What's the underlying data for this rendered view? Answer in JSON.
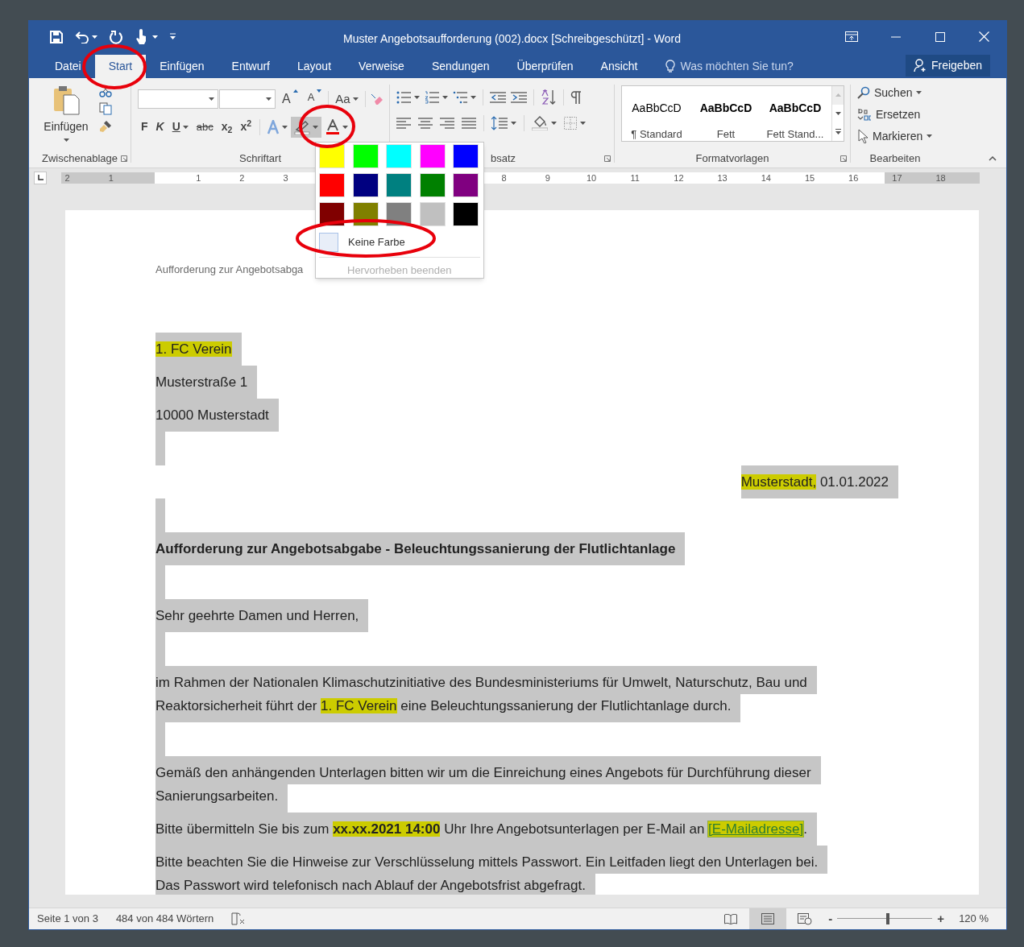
{
  "window": {
    "title": "Muster Angebotsaufforderung (002).docx [Schreibgeschützt] - Word"
  },
  "menu_tabs": [
    {
      "label": "Datei",
      "selected": false
    },
    {
      "label": "Start",
      "selected": true
    },
    {
      "label": "Einfügen",
      "selected": false
    },
    {
      "label": "Entwurf",
      "selected": false
    },
    {
      "label": "Layout",
      "selected": false
    },
    {
      "label": "Verweise",
      "selected": false
    },
    {
      "label": "Sendungen",
      "selected": false
    },
    {
      "label": "Überprüfen",
      "selected": false
    },
    {
      "label": "Ansicht",
      "selected": false
    }
  ],
  "tell_me": {
    "placeholder": "Was möchten Sie tun?"
  },
  "share_button": "Freigeben",
  "ribbon": {
    "clipboard": {
      "paste": "Einfügen",
      "label": "Zwischenablage"
    },
    "font": {
      "label": "Schriftart",
      "grow": "A",
      "shrink": "A",
      "change_case": "Aa",
      "bold": "F",
      "italic": "K",
      "underline": "U",
      "strike": "abc",
      "subscript": "x$_{2}$",
      "superscript": "x$^{2}$",
      "highlight_pressed": true
    },
    "paragraph": {
      "label": "bsatz"
    },
    "styles": {
      "label": "Formatvorlagen",
      "items": [
        {
          "preview": "AaBbCcD",
          "name": "¶ Standard",
          "bold": false
        },
        {
          "preview": "AaBbCcD",
          "name": "Fett",
          "bold": true
        },
        {
          "preview": "AaBbCcD",
          "name": "Fett Stand...",
          "bold": true
        }
      ]
    },
    "editing": {
      "label": "Bearbeiten",
      "items": [
        {
          "label": "Suchen",
          "kind": "search"
        },
        {
          "label": "Ersetzen",
          "kind": "replace"
        },
        {
          "label": "Markieren",
          "kind": "select"
        }
      ]
    }
  },
  "ruler": {
    "numbers": [
      "2",
      "1",
      "1",
      "2",
      "3",
      "8",
      "9",
      "10",
      "11",
      "12",
      "13",
      "14",
      "15",
      "16",
      "17",
      "18"
    ]
  },
  "highlight_menu": {
    "colors": [
      {
        "color": "#ffff00"
      },
      {
        "color": "#00ff00"
      },
      {
        "color": "#00ffff"
      },
      {
        "color": "#ff00ff"
      },
      {
        "color": "#0000ff"
      },
      {
        "color": "#ff0000"
      },
      {
        "color": "#000080"
      },
      {
        "color": "#008080"
      },
      {
        "color": "#008000"
      },
      {
        "color": "#800080"
      },
      {
        "color": "#800000"
      },
      {
        "color": "#808000"
      },
      {
        "color": "#808080"
      },
      {
        "color": "#c0c0c0"
      },
      {
        "color": "#000000"
      }
    ],
    "no_color": "Keine Farbe",
    "stop": "Hervorheben beenden",
    "stop_disabled": true
  },
  "document": {
    "header": "Aufforderung zur Angebotsabga",
    "paragraphs": [
      {
        "kind": "text",
        "lines": [
          [
            {
              "text": "1. FC Verein",
              "highlight": true
            }
          ]
        ]
      },
      {
        "kind": "text",
        "lines": [
          [
            {
              "text": "Musterstraße 1",
              "highlight": false
            }
          ]
        ]
      },
      {
        "kind": "text",
        "lines": [
          [
            {
              "text": "10000 Musterstadt",
              "highlight": false
            }
          ]
        ]
      },
      {
        "kind": "empty"
      },
      {
        "kind": "right_text",
        "lines": [
          [
            {
              "text": "Musterstadt,",
              "highlight": true
            },
            {
              "text": " 01.01.2022",
              "highlight": false
            }
          ]
        ]
      },
      {
        "kind": "empty"
      },
      {
        "kind": "text",
        "lines": [
          [
            {
              "text": "Aufforderung zur Angebotsabgabe - Beleuchtungssanierung der Flutlichtanlage",
              "highlight": false,
              "bold": true
            }
          ]
        ]
      },
      {
        "kind": "empty"
      },
      {
        "kind": "text",
        "lines": [
          [
            {
              "text": "Sehr geehrte Damen und Herren,",
              "highlight": false
            }
          ]
        ]
      },
      {
        "kind": "empty"
      },
      {
        "kind": "text",
        "lines": [
          [
            {
              "text": "im Rahmen der Nationalen Klimaschutzinitiative des Bundesministeriums für Umwelt, Naturschutz, Bau und",
              "highlight": false
            }
          ],
          [
            {
              "text": "Reaktorsicherheit führt der ",
              "highlight": false
            },
            {
              "text": "1. FC Verein",
              "highlight": true
            },
            {
              "text": " eine Beleuchtungssanierung der Flutlichtanlage durch.",
              "highlight": false
            }
          ]
        ]
      },
      {
        "kind": "empty"
      },
      {
        "kind": "text",
        "lines": [
          [
            {
              "text": "Gemäß den anhängenden Unterlagen bitten wir um die Einreichung eines Angebots für Durchführung dieser",
              "highlight": false
            }
          ],
          [
            {
              "text": "Sanierungsarbeiten.",
              "highlight": false
            }
          ]
        ]
      },
      {
        "kind": "text",
        "lines": [
          [
            {
              "text": "Bitte übermitteln Sie bis zum ",
              "highlight": false
            },
            {
              "text": "xx.xx.2021 14:00",
              "highlight": true,
              "bold": true
            },
            {
              "text": " Uhr Ihre Angebotsunterlagen per E-Mail an ",
              "highlight": false
            },
            {
              "text": "[E-Mailadresse]",
              "highlight": true,
              "link": true
            },
            {
              "text": ".",
              "highlight": false
            }
          ]
        ]
      },
      {
        "kind": "text",
        "lines": [
          [
            {
              "text": "Bitte beachten Sie die Hinweise zur Verschlüsselung mittels Passwort. Ein Leitfaden liegt den Unterlagen bei.",
              "highlight": false
            }
          ],
          [
            {
              "text": "Das Passwort wird telefonisch nach Ablauf der Angebotsfrist abgefragt.",
              "highlight": false
            }
          ]
        ]
      }
    ]
  },
  "status_bar": {
    "page": "Seite 1 von 3",
    "words": "484 von 484 Wörtern",
    "views": [
      {
        "kind": "read",
        "selected": false
      },
      {
        "kind": "print",
        "selected": true
      },
      {
        "kind": "web",
        "selected": false
      }
    ],
    "zoom_out": "-",
    "zoom_in": "+",
    "zoom": {
      "level": 0.53
    },
    "zoom_label": "120 %"
  }
}
